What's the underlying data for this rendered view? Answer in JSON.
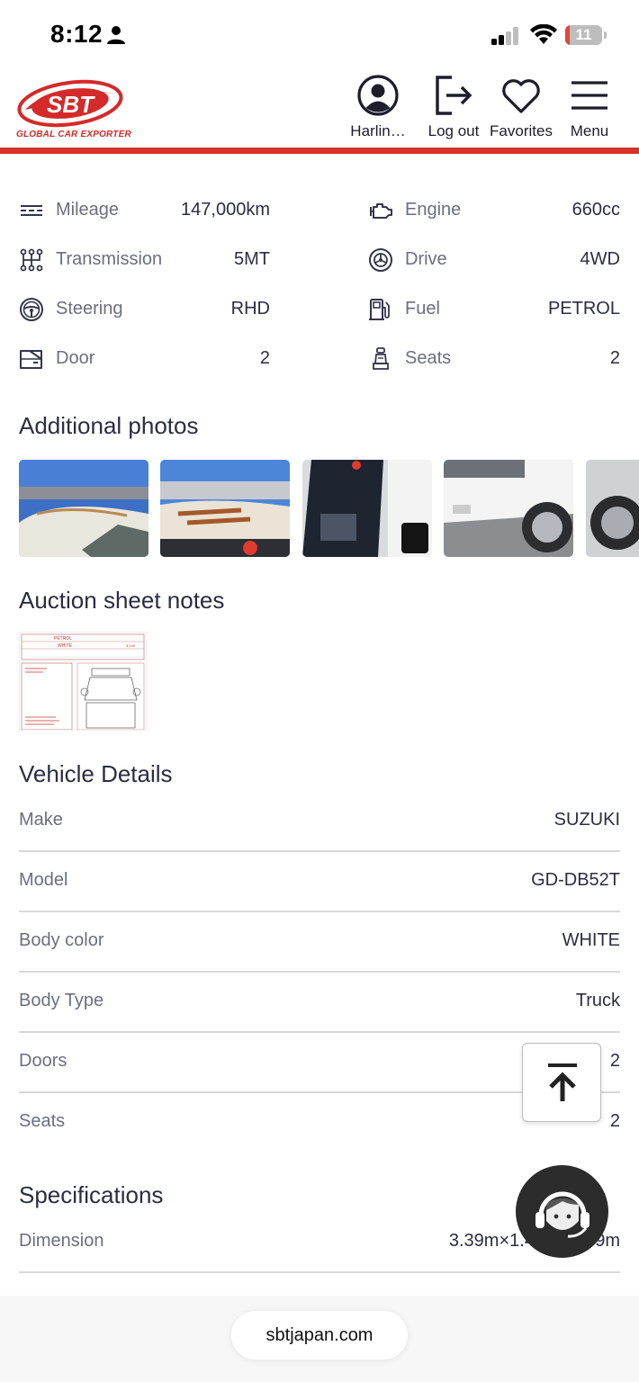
{
  "status_bar": {
    "time": "8:12",
    "battery": "11",
    "battery_level": 0.11,
    "person_icon": "person-icon",
    "signal_icon": "cellular-signal-icon",
    "wifi_icon": "wifi-icon"
  },
  "header": {
    "logo_text": "SBT",
    "logo_subtitle": "GLOBAL CAR EXPORTER",
    "nav": [
      {
        "label": "Harlin…",
        "icon": "user-icon"
      },
      {
        "label": "Log out",
        "icon": "logout-icon"
      },
      {
        "label": "Favorites",
        "icon": "heart-icon"
      },
      {
        "label": "Menu",
        "icon": "menu-icon"
      }
    ],
    "brand_color": "#d6312b"
  },
  "specs": [
    {
      "label": "Mileage",
      "value": "147,000km",
      "icon": "mileage-icon"
    },
    {
      "label": "Engine",
      "value": "660cc",
      "icon": "engine-icon"
    },
    {
      "label": "Transmission",
      "value": "5MT",
      "icon": "gearbox-icon"
    },
    {
      "label": "Drive",
      "value": "4WD",
      "icon": "wheel-icon"
    },
    {
      "label": "Steering",
      "value": "RHD",
      "icon": "steering-wheel-icon"
    },
    {
      "label": "Fuel",
      "value": "PETROL",
      "icon": "fuel-pump-icon"
    },
    {
      "label": "Door",
      "value": "2",
      "icon": "car-door-icon"
    },
    {
      "label": "Seats",
      "value": "2",
      "icon": "seat-icon"
    }
  ],
  "sections": {
    "additional_photos": "Additional photos",
    "auction_sheet": "Auction sheet notes",
    "vehicle_details": "Vehicle Details",
    "specifications": "Specifications"
  },
  "auction_sheet_text": {
    "fuel": "PETROL",
    "color": "WHITE",
    "mileage": "3,140"
  },
  "vehicle_details": [
    {
      "label": "Make",
      "value": "SUZUKI"
    },
    {
      "label": "Model",
      "value": "GD-DB52T"
    },
    {
      "label": "Body color",
      "value": "WHITE"
    },
    {
      "label": "Body Type",
      "value": "Truck"
    },
    {
      "label": "Doors",
      "value": "2"
    },
    {
      "label": "Seats",
      "value": "2"
    }
  ],
  "specifications": [
    {
      "label": "Dimension",
      "value": "3.39m×1.47m×1.79m"
    }
  ],
  "floating": {
    "scroll_top_icon": "arrow-up-to-top-icon",
    "support_icon": "customer-support-icon"
  },
  "browser": {
    "url": "sbtjapan.com"
  }
}
